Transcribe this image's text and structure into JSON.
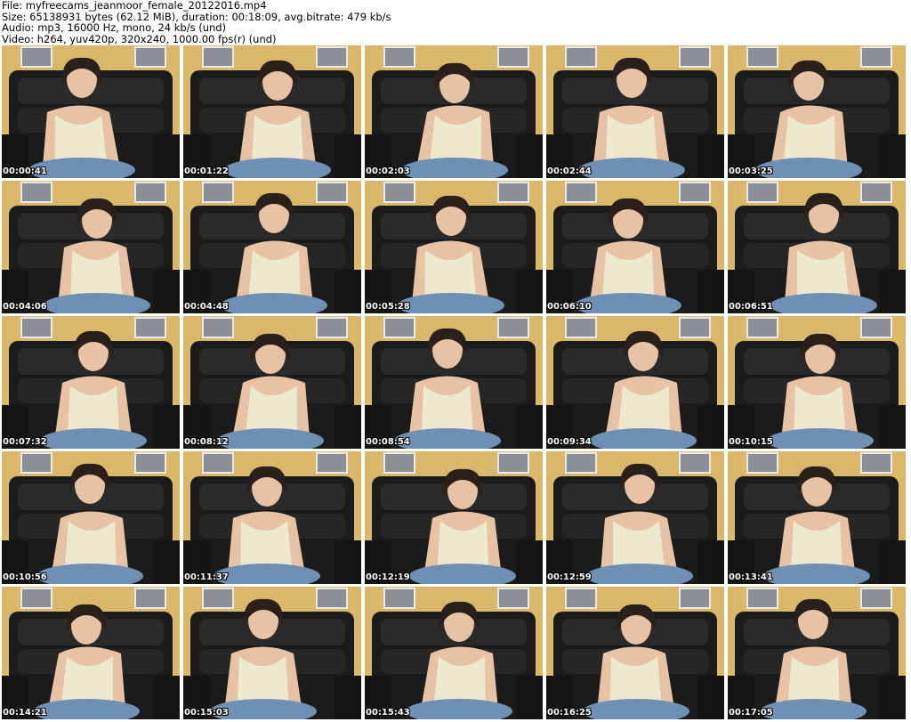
{
  "header": {
    "file": "File: myfreecams_jeanmoor_female_20122016.mp4",
    "size": "Size: 65138931 bytes (62.12 MiB), duration: 00:18:09, avg.bitrate: 479 kb/s",
    "audio": "Audio: mp3, 16000 Hz, mono, 24 kb/s (und)",
    "video": "Video: h264, yuv420p, 320x240, 1000.00 fps(r) (und)"
  },
  "colors": {
    "wall": "#d9b86b",
    "sofa": "#1b1b1b",
    "top": "#ece9cf",
    "jeans": "#6f8fb5",
    "skin": "#e7c2a4",
    "hair": "#2a1f1a"
  },
  "thumbnails": [
    {
      "timestamp": "00:00:41"
    },
    {
      "timestamp": "00:01:22"
    },
    {
      "timestamp": "00:02:03"
    },
    {
      "timestamp": "00:02:44"
    },
    {
      "timestamp": "00:03:25"
    },
    {
      "timestamp": "00:04:06"
    },
    {
      "timestamp": "00:04:48"
    },
    {
      "timestamp": "00:05:28"
    },
    {
      "timestamp": "00:06:10"
    },
    {
      "timestamp": "00:06:51"
    },
    {
      "timestamp": "00:07:32"
    },
    {
      "timestamp": "00:08:12"
    },
    {
      "timestamp": "00:08:54"
    },
    {
      "timestamp": "00:09:34"
    },
    {
      "timestamp": "00:10:15"
    },
    {
      "timestamp": "00:10:56"
    },
    {
      "timestamp": "00:11:37"
    },
    {
      "timestamp": "00:12:19"
    },
    {
      "timestamp": "00:12:59"
    },
    {
      "timestamp": "00:13:41"
    },
    {
      "timestamp": "00:14:21"
    },
    {
      "timestamp": "00:15:03"
    },
    {
      "timestamp": "00:15:43"
    },
    {
      "timestamp": "00:16:25"
    },
    {
      "timestamp": "00:17:05"
    }
  ]
}
